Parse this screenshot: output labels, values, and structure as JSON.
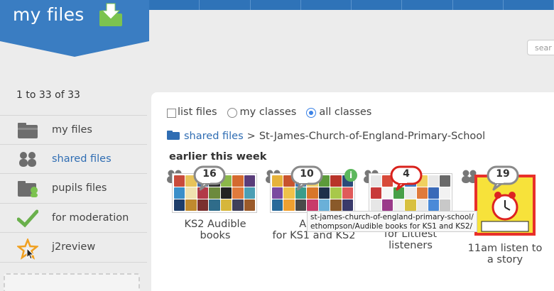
{
  "app": {
    "title": "my files"
  },
  "search": {
    "placeholder": "sear"
  },
  "count_text": "1 to 33 of 33",
  "sidebar": {
    "items": [
      {
        "label": "my files",
        "icon": "folder-icon",
        "active": false
      },
      {
        "label": "shared files",
        "icon": "people-icon",
        "active": true
      },
      {
        "label": "pupils files",
        "icon": "pupil-folder-icon",
        "active": false
      },
      {
        "label": "for moderation",
        "icon": "checkmark-icon",
        "active": false
      },
      {
        "label": "j2review",
        "icon": "star-icon",
        "active": false
      }
    ]
  },
  "filters": {
    "list_files": "list files",
    "my_classes": "my classes",
    "all_classes": "all classes",
    "selected": "all classes"
  },
  "breadcrumb": {
    "root": "shared files",
    "separator": ">",
    "current": "St-James-Church-of-England-Primary-School"
  },
  "section": {
    "heading": "earlier this week"
  },
  "tiles": [
    {
      "count": "16",
      "label_line1": "KS2 Audible",
      "label_line2": "books"
    },
    {
      "count": "10",
      "label_line1": "Audib",
      "label_line2": "for KS1 and KS2"
    },
    {
      "count": "4",
      "label_line1": "for Littlest",
      "label_line2": "listeners"
    },
    {
      "count": "19",
      "label_line1": "11am listen to",
      "label_line2": "a story"
    }
  ],
  "tooltip": {
    "line1": "st-james-church-of-england-primary-school/",
    "line2": "ethompson/Audible books for KS1 and KS2/"
  },
  "colors": {
    "brand_blue": "#3a7dc2",
    "link_blue": "#2f6db3",
    "badge_red": "#d9221c",
    "green": "#6ab04c"
  }
}
